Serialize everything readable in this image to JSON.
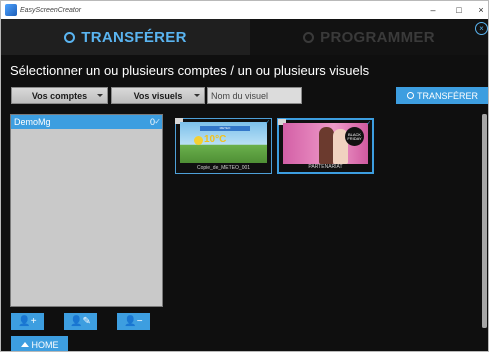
{
  "window": {
    "title": "EasyScreenCreator",
    "controls": {
      "minimize": "–",
      "maximize": "□",
      "close": "×"
    }
  },
  "tabs": [
    {
      "label": "TRANSFÉRER",
      "icon": "refresh-icon",
      "active": true
    },
    {
      "label": "PROGRAMMER",
      "icon": "clock-icon",
      "active": false
    }
  ],
  "tab_close": "×",
  "instruction": "Sélectionner un ou plusieurs comptes / un ou plusieurs visuels",
  "filters": {
    "accounts_label": "Vos comptes",
    "visuals_label": "Vos visuels",
    "name_placeholder": "Nom du visuel",
    "transfer_label": "TRANSFÉRER"
  },
  "accounts": [
    {
      "name": "DemoMg",
      "count": "0",
      "check": "✓",
      "selected": true
    }
  ],
  "account_actions": [
    {
      "icon": "user-add-icon",
      "glyph": "👤+"
    },
    {
      "icon": "user-edit-icon",
      "glyph": "👤✎"
    },
    {
      "icon": "user-remove-icon",
      "glyph": "👤−"
    }
  ],
  "visuals": [
    {
      "caption": "Copie_de_METEO_001",
      "banner": "METEO",
      "temp": "10°C",
      "check": "✓"
    },
    {
      "caption": "PARTENARIAT",
      "badge": "BLACK FRIDAY",
      "check": "✓"
    }
  ],
  "home_label": "HOME",
  "colors": {
    "accent": "#3d9ee0",
    "tab_active_text": "#5ab4f0",
    "background": "#0f0f0f"
  }
}
